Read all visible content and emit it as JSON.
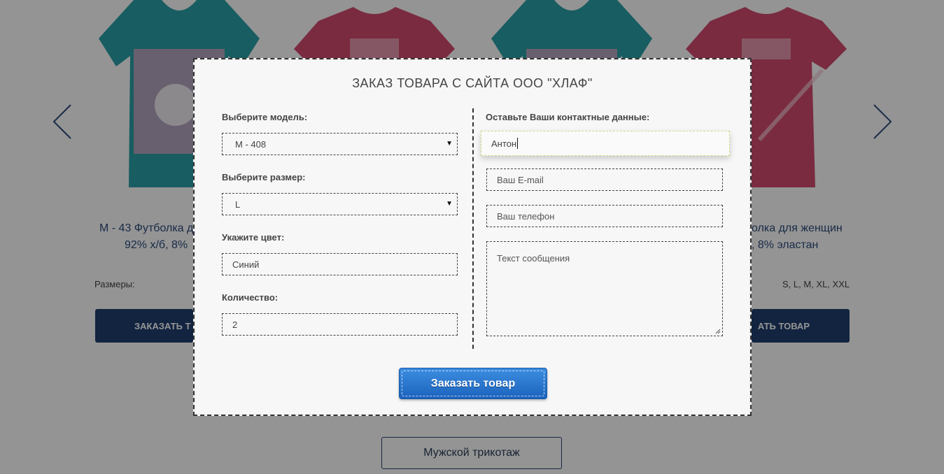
{
  "background": {
    "products": [
      {
        "title_line1": "M - 43 Футболка д",
        "title_line2": "92% х/б, 8% ",
        "sizes_label": "Размеры:",
        "order_button": "ЗАКАЗАТЬ Т",
        "shirt_color": "#2aa0a8"
      },
      {
        "shirt_color": "#d24a6e"
      },
      {
        "shirt_color": "#2aa0a8"
      },
      {
        "title_line1": "олка для женщин",
        "title_line2": ", 8% эластан",
        "sizes_value": "S, L, M, XL, XXL",
        "order_button": "АТЬ ТОВАР",
        "shirt_color": "#d24a6e"
      }
    ],
    "category_button": "Мужской трикотаж",
    "prev_icon": "chevron-left-icon",
    "next_icon": "chevron-right-icon"
  },
  "modal": {
    "title": "ЗАКАЗ ТОВАРА С САЙТА ООО \"ХЛАФ\"",
    "left": {
      "model_label": "Выберите модель:",
      "model_value": "M - 408",
      "size_label": "Выберите размер:",
      "size_value": "L",
      "color_label": "Укажите цвет:",
      "color_value": "Синий",
      "qty_label": "Количество:",
      "qty_value": "2"
    },
    "right": {
      "contact_label": "Оставьте Ваши контактные данные:",
      "name_value": "Антон",
      "email_placeholder": "Ваш E-mail",
      "phone_placeholder": "Ваш телефон",
      "message_placeholder": "Текст сообщения"
    },
    "submit_label": "Заказать товар"
  }
}
